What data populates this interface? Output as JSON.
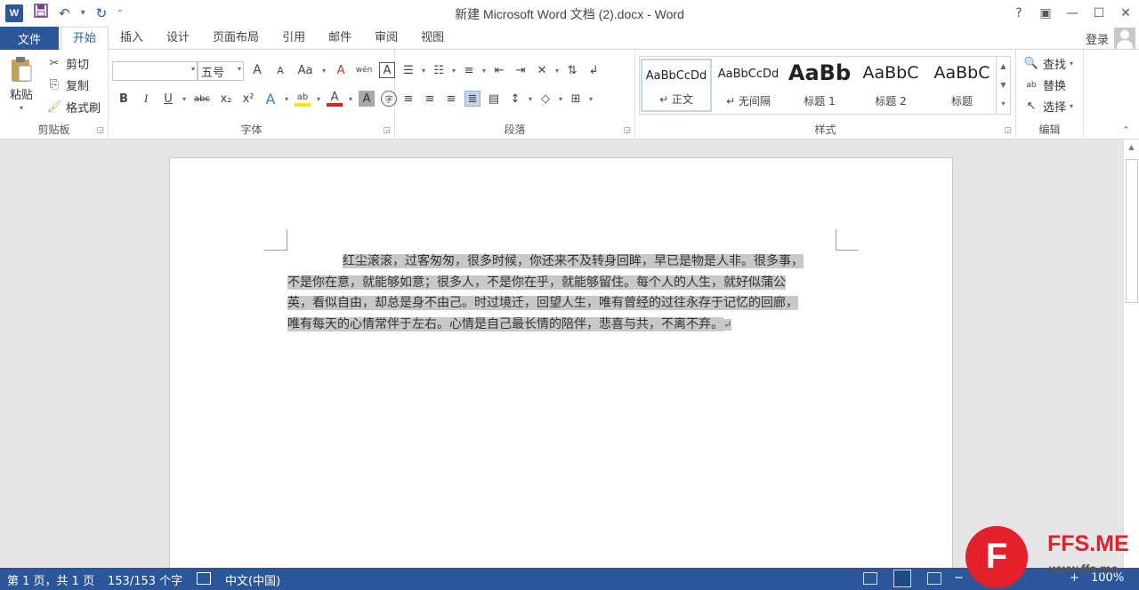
{
  "titlebar": {
    "app_icon": "W",
    "title": "新建 Microsoft Word 文档 (2).docx - Word",
    "controls": [
      "?",
      "▣",
      "—",
      "☐",
      "✕"
    ]
  },
  "tabs": {
    "file": "文件",
    "items": [
      "开始",
      "插入",
      "设计",
      "页面布局",
      "引用",
      "邮件",
      "审阅",
      "视图"
    ],
    "active_index": 0,
    "login": "登录"
  },
  "ribbon": {
    "clipboard": {
      "label": "剪贴板",
      "paste": "粘贴",
      "cut": "剪切",
      "copy": "复制",
      "format_painter": "格式刷"
    },
    "font": {
      "label": "字体",
      "font_name": "",
      "font_size": "五号",
      "grow": "A",
      "shrink": "A",
      "change_case": "Aa",
      "clear": "A",
      "phonetic": "wén",
      "border": "A",
      "bold": "B",
      "italic": "I",
      "underline": "U",
      "strike": "abc",
      "subscript": "x₂",
      "superscript": "x²",
      "text_effects": "A",
      "highlight": "ab",
      "font_color": "A",
      "char_shading": "A",
      "enclose": "字"
    },
    "paragraph": {
      "label": "段落"
    },
    "styles": {
      "label": "样式",
      "tiles": [
        {
          "sample": "AaBbCcDd",
          "name": "↵ 正文"
        },
        {
          "sample": "AaBbCcDd",
          "name": "↵ 无间隔"
        },
        {
          "sample": "AaBb",
          "name": "标题 1"
        },
        {
          "sample": "AaBbC",
          "name": "标题 2"
        },
        {
          "sample": "AaBbC",
          "name": "标题"
        }
      ]
    },
    "editing": {
      "label": "编辑",
      "find": "查找",
      "replace": "替换",
      "select": "选择"
    }
  },
  "document": {
    "lines": [
      "红尘滚滚，过客匆匆，很多时候，你还来不及转身回眸，早已是物是人非。很多事，",
      "不是你在意，就能够如意；很多人，不是你在乎，就能够留住。每个人的人生，就好似蒲公",
      "英，看似自由，却总是身不由己。时过境迁，回望人生，唯有曾经的过往永存于记忆的回廊，",
      "唯有每天的心情常伴于左右。心情是自己最长情的陪伴，悲喜与共，不离不弃。"
    ],
    "para_mark": "↵"
  },
  "status": {
    "page": "第 1 页，共 1 页",
    "words": "153/153 个字",
    "language": "中文(中国)",
    "zoom": "100%",
    "zoom_minus": "−",
    "zoom_plus": "+"
  },
  "watermark": {
    "logo_letter": "F",
    "title": "FFS.ME",
    "url": "www.ffs.me",
    "color": "#e4202a"
  },
  "colors": {
    "accent": "#2b579a",
    "selection": "#c8c8c8",
    "workspace": "#e6e6e6"
  }
}
